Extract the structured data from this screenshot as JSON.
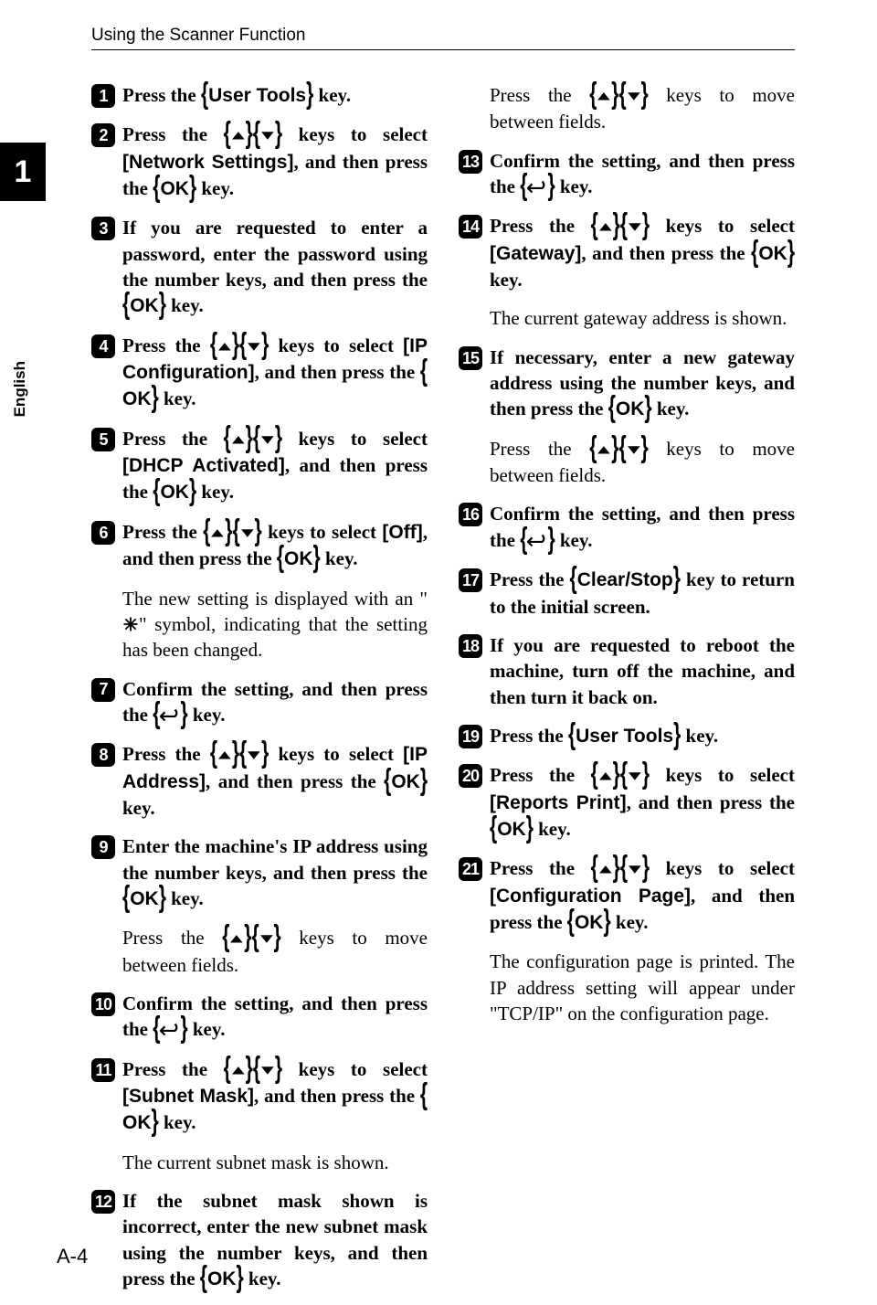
{
  "running_head": "Using the Scanner Function",
  "chapter_tab": "1",
  "language_label": "English",
  "page_number": "A-4",
  "keys": {
    "user_tools": "User Tools",
    "ok": "OK",
    "clear_stop": "Clear/Stop"
  },
  "settings": {
    "network_settings": "Network Settings",
    "ip_configuration": "IP Configuration",
    "dhcp_activated": "DHCP Activated",
    "off": "Off",
    "ip_address": "IP Address",
    "subnet_mask": "Subnet Mask",
    "gateway": "Gateway",
    "reports_print": "Reports Print",
    "configuration_page": "Configuration Page"
  },
  "text": {
    "press_the": "Press the ",
    "key_period": " key.",
    "press_arrows_select": "Press the ",
    "keys_to_select": " keys to select ",
    "and_then_press_the": ", and then press the ",
    "and_then_press_the_ok_key": ", and then press the ",
    "step3": "If you are requested to enter a password, enter the password using the number keys, and then press the ",
    "step6_sub": "The new setting is displayed with an \"",
    "step6_sub2": "\" symbol, indicating that the setting has been changed.",
    "confirm_setting": "Confirm the setting, and then press the ",
    "step9": "Enter the machine's IP address using the number keys, and then press the ",
    "move_fields": "Press the ",
    "move_fields2": " keys to move between fields.",
    "step11_sub": "The current subnet mask is shown.",
    "step12": "If the subnet mask shown is incorrect, enter the new subnet mask using the number keys, and then press the ",
    "step14_sub": "The current gateway address is shown.",
    "step15": "If necessary, enter a new gateway address using the number keys, and then press the ",
    "step17": "Press the ",
    "step17_b": " key to return to the initial screen.",
    "step18": "If you are requested to reboot the machine, turn off the machine, and then turn it back on.",
    "step21_sub": "The configuration page is printed. The IP address setting will appear under \"TCP/IP\" on the configuration page."
  }
}
